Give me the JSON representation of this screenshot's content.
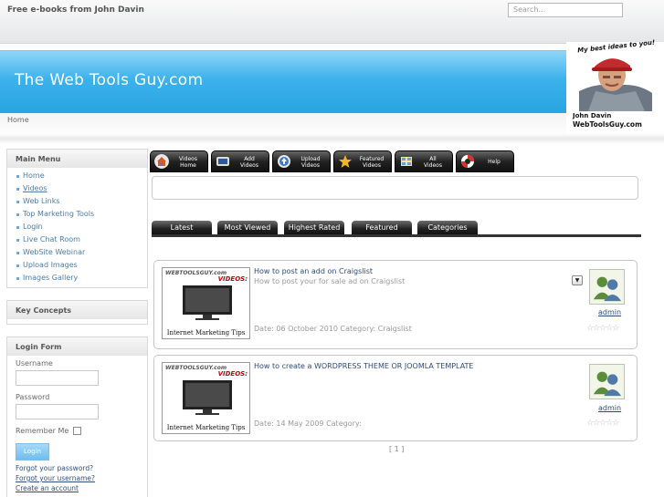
{
  "header": {
    "site_title": "Free e-books from John Davin",
    "search_placeholder": "Search..."
  },
  "banner": {
    "logo_text": "The Web Tools Guy.com",
    "photo_tag": "My best ideas to you!",
    "photo_caption_name": "John Davin",
    "photo_caption_site": "WebToolsGuy.com"
  },
  "breadcrumb": {
    "home": "Home"
  },
  "main_menu": {
    "title": "Main Menu",
    "items": [
      "Home",
      "Videos",
      "Web Links",
      "Top Marketing Tools",
      "Login",
      "Live Chat Room",
      "WebSite Webinar",
      "Upload Images",
      "Images Gallery"
    ]
  },
  "key_concepts": {
    "title": "Key Concepts"
  },
  "login_form": {
    "title": "Login Form",
    "username_label": "Username",
    "password_label": "Password",
    "remember_label": "Remember Me",
    "login_button": "Login",
    "forgot_password": "Forgot your password?",
    "forgot_username": "Forgot your username?",
    "create_account": "Create an account"
  },
  "toolbar": {
    "tabs": [
      {
        "label1": "Videos",
        "label2": "Home",
        "icon": "home-icon"
      },
      {
        "label1": "Add",
        "label2": "Videos",
        "icon": "monitor-icon"
      },
      {
        "label1": "Upload",
        "label2": "Videos",
        "icon": "upload-icon"
      },
      {
        "label1": "Featured",
        "label2": "Videos",
        "icon": "star-icon"
      },
      {
        "label1": "All",
        "label2": "Videos",
        "icon": "grid-icon"
      },
      {
        "label1": "Help",
        "label2": "",
        "icon": "lifebuoy-icon"
      }
    ]
  },
  "video_tabs": [
    "Latest",
    "Most Viewed",
    "Highest Rated",
    "Featured",
    "Categories"
  ],
  "videos": [
    {
      "title": "How to post an add on Craigslist",
      "description": "How to post your for sale ad on Craigslist",
      "meta": "Date: 06 October 2010  Category: Craigslist",
      "user": "admin",
      "thumb_brand": "WEBTOOLSGUY.com",
      "thumb_tag": "VIDEOS:",
      "thumb_caption": "Internet Marketing Tips",
      "rating": 0
    },
    {
      "title": "How to create a WORDPRESS THEME OR JOOMLA TEMPLATE",
      "description": "",
      "meta": "Date: 14 May 2009  Category:",
      "user": "admin",
      "thumb_brand": "WEBTOOLSGUY.com",
      "thumb_tag": "VIDEOS:",
      "thumb_caption": "Internet Marketing Tips",
      "rating": 0
    }
  ],
  "pager": "[ 1 ]",
  "colors": {
    "banner": "#3cb2ec",
    "link": "#4d7ba4",
    "tab": "#222222"
  }
}
